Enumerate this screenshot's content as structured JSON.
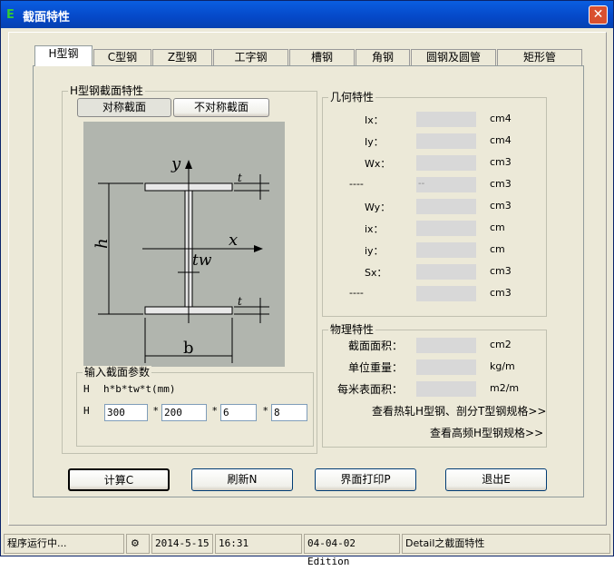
{
  "window": {
    "title": "截面特性",
    "close_symbol": "✕"
  },
  "tabs": [
    {
      "label": "H型钢"
    },
    {
      "label": "C型钢"
    },
    {
      "label": "Z型钢"
    },
    {
      "label": "工字钢"
    },
    {
      "label": "槽钢"
    },
    {
      "label": "角钢"
    },
    {
      "label": "圆钢及圆管"
    },
    {
      "label": "矩形管"
    }
  ],
  "section_group": {
    "title": "H型钢截面特性",
    "sym_btn": "对称截面",
    "asym_btn": "不对称截面"
  },
  "diagram": {
    "y": "y",
    "x": "x",
    "t": "t",
    "h": "h",
    "tw": "tw",
    "b": "b"
  },
  "input_group": {
    "title": "输入截面参数",
    "h_label": "H",
    "formula": "h*b*tw*t(mm)",
    "row_label": "H",
    "star": "*",
    "h": "300",
    "b": "200",
    "tw": "6",
    "t": "8"
  },
  "geometry": {
    "title": "几何特性",
    "rows": [
      {
        "label": "Ix：",
        "unit": "cm4",
        "value": ""
      },
      {
        "label": "Iy：",
        "unit": "cm4",
        "value": ""
      },
      {
        "label": "Wx：",
        "unit": "cm3",
        "value": ""
      },
      {
        "label": "----",
        "unit": "cm3",
        "value": "--"
      },
      {
        "label": "Wy：",
        "unit": "cm3",
        "value": ""
      },
      {
        "label": "ix：",
        "unit": "cm",
        "value": ""
      },
      {
        "label": "iy：",
        "unit": "cm",
        "value": ""
      },
      {
        "label": "Sx：",
        "unit": "cm3",
        "value": ""
      },
      {
        "label": "----",
        "unit": "cm3",
        "value": ""
      }
    ]
  },
  "physical": {
    "title": "物理特性",
    "rows": [
      {
        "label": "截面面积：",
        "unit": "cm2"
      },
      {
        "label": "单位重量：",
        "unit": "kg/m"
      },
      {
        "label": "每米表面积：",
        "unit": "m2/m"
      }
    ],
    "link1": "查看热轧H型钢、剖分T型钢规格>>",
    "link2": "查看高频H型钢规格>>"
  },
  "buttons": {
    "calc": "计算C",
    "refresh": "刷新N",
    "print": "界面打印P",
    "exit": "退出E"
  },
  "status": {
    "running": "程序运行中...",
    "date": "2014-5-15",
    "time": "16:31",
    "edition": "04-04-02 Edition",
    "module": "Detail之截面特性"
  }
}
